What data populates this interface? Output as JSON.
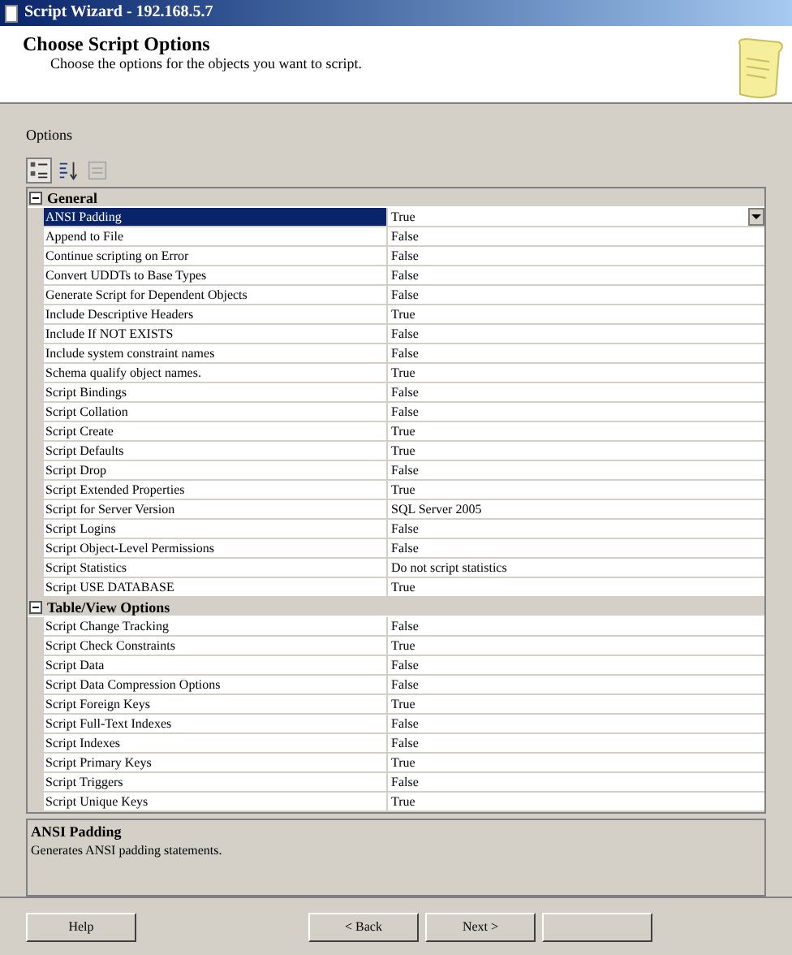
{
  "window": {
    "title": "Script Wizard - 192.168.5.7"
  },
  "header": {
    "title": "Choose Script Options",
    "subtitle": "Choose the options for the objects you want to script."
  },
  "options_label": "Options",
  "toolbar": [
    {
      "kind": "categorized",
      "selected": true
    },
    {
      "kind": "alphabetical",
      "selected": false
    },
    {
      "kind": "pages",
      "selected": false
    }
  ],
  "grid": [
    {
      "category": "General",
      "expanded": true,
      "properties": [
        {
          "name": "ANSI Padding",
          "value": "True",
          "selected": true
        },
        {
          "name": "Append to File",
          "value": "False",
          "selected": false
        },
        {
          "name": "Continue scripting on Error",
          "value": "False",
          "selected": false
        },
        {
          "name": "Convert UDDTs to Base Types",
          "value": "False",
          "selected": false
        },
        {
          "name": "Generate Script for Dependent Objects",
          "value": "False",
          "selected": false
        },
        {
          "name": "Include Descriptive Headers",
          "value": "True",
          "selected": false
        },
        {
          "name": "Include If NOT EXISTS",
          "value": "False",
          "selected": false
        },
        {
          "name": "Include system constraint names",
          "value": "False",
          "selected": false
        },
        {
          "name": "Schema qualify object names.",
          "value": "True",
          "selected": false
        },
        {
          "name": "Script Bindings",
          "value": "False",
          "selected": false
        },
        {
          "name": "Script Collation",
          "value": "False",
          "selected": false
        },
        {
          "name": "Script Create",
          "value": "True",
          "selected": false
        },
        {
          "name": "Script Defaults",
          "value": "True",
          "selected": false
        },
        {
          "name": "Script Drop",
          "value": "False",
          "selected": false
        },
        {
          "name": "Script Extended Properties",
          "value": "True",
          "selected": false
        },
        {
          "name": "Script for Server Version",
          "value": "SQL Server 2005",
          "selected": false
        },
        {
          "name": "Script Logins",
          "value": "False",
          "selected": false
        },
        {
          "name": "Script Object-Level Permissions",
          "value": "False",
          "selected": false
        },
        {
          "name": "Script Statistics",
          "value": "Do not script statistics",
          "selected": false
        },
        {
          "name": "Script USE DATABASE",
          "value": "True",
          "selected": false
        }
      ]
    },
    {
      "category": "Table/View Options",
      "expanded": true,
      "properties": [
        {
          "name": "Script Change Tracking",
          "value": "False",
          "selected": false
        },
        {
          "name": "Script Check Constraints",
          "value": "True",
          "selected": false
        },
        {
          "name": "Script Data",
          "value": "False",
          "selected": false
        },
        {
          "name": "Script Data Compression Options",
          "value": "False",
          "selected": false
        },
        {
          "name": "Script Foreign Keys",
          "value": "True",
          "selected": false
        },
        {
          "name": "Script Full-Text Indexes",
          "value": "False",
          "selected": false
        },
        {
          "name": "Script Indexes",
          "value": "False",
          "selected": false
        },
        {
          "name": "Script Primary Keys",
          "value": "True",
          "selected": false
        },
        {
          "name": "Script Triggers",
          "value": "False",
          "selected": false
        },
        {
          "name": "Script Unique Keys",
          "value": "True",
          "selected": false
        }
      ]
    }
  ],
  "description": {
    "title": "ANSI Padding",
    "text": "Generates ANSI padding statements."
  },
  "buttons": [
    {
      "label": "Help"
    },
    {
      "label": "< Back"
    },
    {
      "label": "Next >"
    },
    {
      "covered": true
    }
  ]
}
